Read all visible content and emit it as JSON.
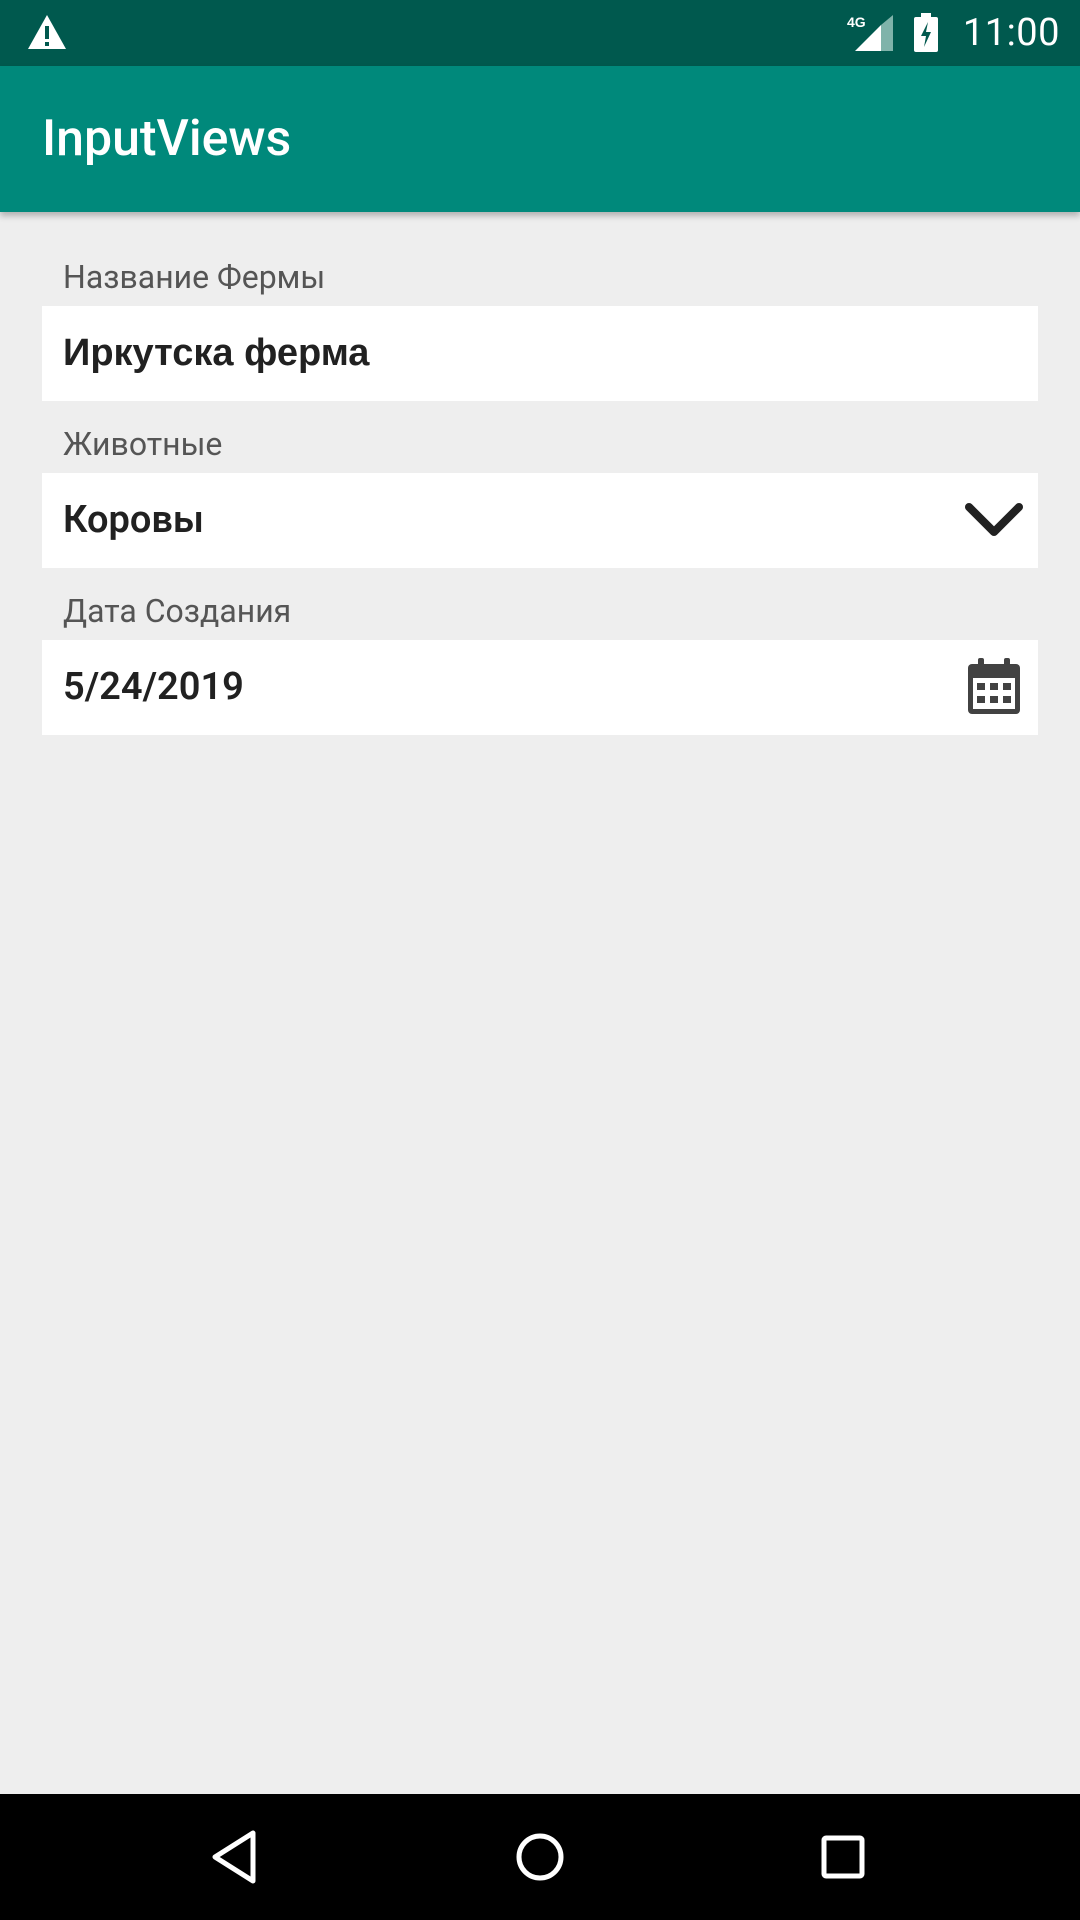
{
  "status_bar": {
    "time": "11:00",
    "network_label": "4G",
    "icons": [
      "warning-icon",
      "signal-icon",
      "battery-charging-icon"
    ]
  },
  "app_bar": {
    "title": "InputViews"
  },
  "form": {
    "farm_name": {
      "label": "Название Фермы",
      "value": "Иркутска ферма"
    },
    "animals": {
      "label": "Животные",
      "selected": "Коровы",
      "icon": "chevron-down-icon"
    },
    "created_date": {
      "label": "Дата Создания",
      "value": "5/24/2019",
      "icon": "calendar-icon"
    }
  },
  "nav_bar": {
    "buttons": [
      "back-icon",
      "home-icon",
      "recents-icon"
    ]
  },
  "colors": {
    "status_bar": "#00594e",
    "app_bar": "#00897b",
    "background": "#eeeeee",
    "field": "#ffffff",
    "nav_bar": "#000000"
  }
}
